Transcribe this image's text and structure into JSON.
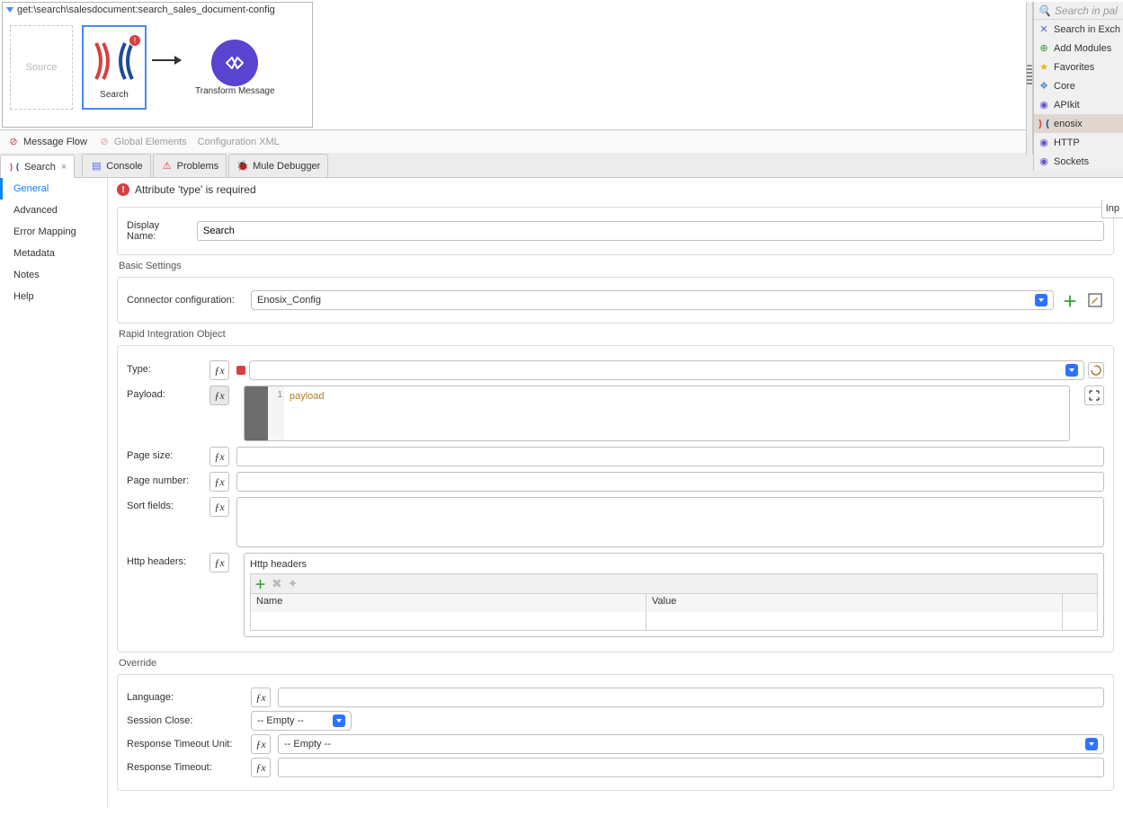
{
  "flow": {
    "title": "get:\\search\\salesdocument:search_sales_document-config",
    "source_label": "Source",
    "search_node": "Search",
    "transform_node": "Transform Message"
  },
  "canvas_tabs": {
    "message_flow": "Message Flow",
    "global_elements": "Global Elements",
    "configuration_xml": "Configuration XML"
  },
  "view_tabs": {
    "search": "Search",
    "console": "Console",
    "problems": "Problems",
    "mule_debugger": "Mule Debugger"
  },
  "side_nav": [
    "General",
    "Advanced",
    "Error Mapping",
    "Metadata",
    "Notes",
    "Help"
  ],
  "error_banner": "Attribute 'type' is required",
  "form": {
    "display_name_label": "Display Name:",
    "display_name_value": "Search",
    "basic_settings_title": "Basic Settings",
    "connector_config_label": "Connector configuration:",
    "connector_config_value": "Enosix_Config",
    "rio_title": "Rapid Integration Object",
    "type_label": "Type:",
    "payload_label": "Payload:",
    "payload_code": "payload",
    "page_size_label": "Page size:",
    "page_number_label": "Page number:",
    "sort_fields_label": "Sort fields:",
    "http_headers_label": "Http headers:",
    "http_headers_title": "Http headers",
    "header_name_col": "Name",
    "header_value_col": "Value",
    "override_title": "Override",
    "language_label": "Language:",
    "session_close_label": "Session Close:",
    "session_close_value": "-- Empty --",
    "resp_timeout_unit_label": "Response Timeout Unit:",
    "resp_timeout_unit_value": "-- Empty --",
    "resp_timeout_label": "Response Timeout:"
  },
  "palette": {
    "search_placeholder": "Search in pal",
    "items": [
      {
        "label": "Search in Exch"
      },
      {
        "label": "Add Modules"
      },
      {
        "label": "Favorites"
      },
      {
        "label": "Core"
      },
      {
        "label": "APIkit"
      },
      {
        "label": "enosix"
      },
      {
        "label": "HTTP"
      },
      {
        "label": "Sockets"
      }
    ]
  },
  "input_tab": "Inp"
}
